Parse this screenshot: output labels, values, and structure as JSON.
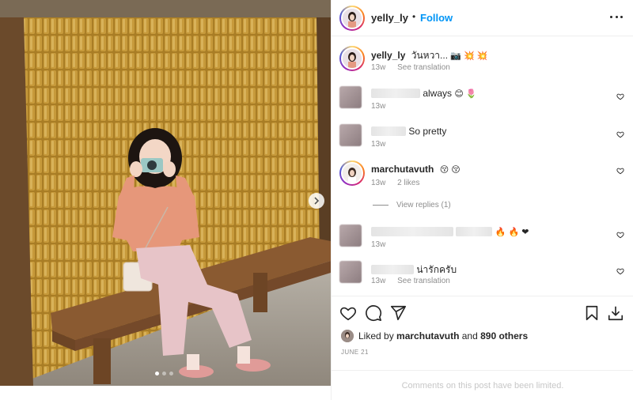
{
  "post": {
    "username": "yelly_ly",
    "separator": "•",
    "follow_label": "Follow",
    "caption_text": "วันหวา...",
    "caption_emojis": "📷 💥 💥",
    "caption_time": "13w",
    "see_translation": "See translation"
  },
  "comments": [
    {
      "username": "",
      "text": "always",
      "emojis": "😊 🌷",
      "time": "13w",
      "likes": "",
      "translation": ""
    },
    {
      "username": "",
      "text": "So pretty",
      "emojis": "",
      "time": "13w",
      "likes": "",
      "translation": ""
    },
    {
      "username": "marchutavuth",
      "text": "",
      "emojis": "😚 😚",
      "time": "13w",
      "likes": "2 likes",
      "translation": ""
    },
    {
      "username": "",
      "text": "",
      "emojis": "🔥 🔥 ❤",
      "time": "13w",
      "likes": "",
      "translation": ""
    },
    {
      "username": "",
      "text": "น่ารักครับ",
      "emojis": "",
      "time": "13w",
      "likes": "",
      "translation": "See translation"
    }
  ],
  "view_replies": "View replies (1)",
  "likes": {
    "prefix": "Liked by",
    "user": "marchutavuth",
    "and": "and",
    "others": "890 others"
  },
  "date": "JUNE 21",
  "limited_notice": "Comments on this post have been limited.",
  "icons": {
    "more": "more-options-icon",
    "heart": "heart-icon",
    "comment": "comment-icon",
    "share": "share-icon",
    "save": "bookmark-icon",
    "download": "download-icon",
    "next": "chevron-right-icon"
  },
  "colors": {
    "follow": "#0095f6",
    "muted": "#8e8e8e",
    "text": "#262626"
  }
}
